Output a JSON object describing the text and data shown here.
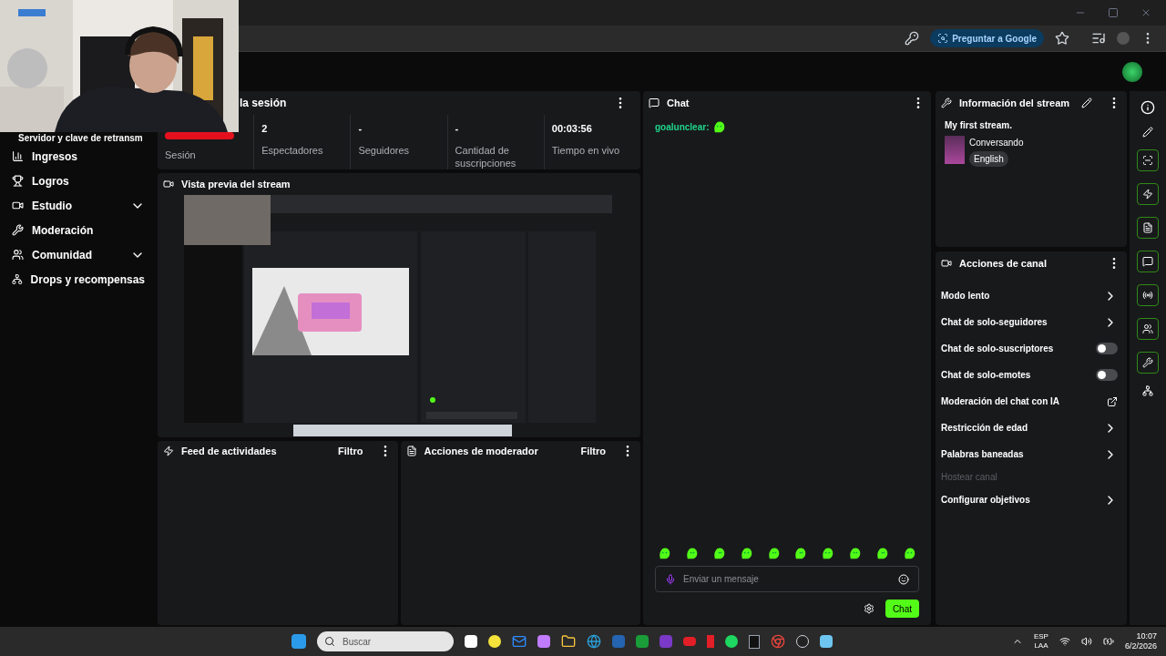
{
  "browser": {
    "ask_button": "Preguntar a Google"
  },
  "sidebar": {
    "partial_item": "Servidor y clave de retransm",
    "items": [
      {
        "label": "Ingresos",
        "expandable": false
      },
      {
        "label": "Logros",
        "expandable": false
      },
      {
        "label": "Estudio",
        "expandable": true
      },
      {
        "label": "Moderación",
        "expandable": false
      },
      {
        "label": "Comunidad",
        "expandable": true
      },
      {
        "label": "Drops y recompensas",
        "expandable": false
      }
    ]
  },
  "session": {
    "title": "la sesión",
    "stats": [
      {
        "kind": "badge",
        "label": "Sesión"
      },
      {
        "kind": "value",
        "value": "2",
        "label": "Espectadores"
      },
      {
        "kind": "value",
        "value": "-",
        "label": "Seguidores"
      },
      {
        "kind": "value",
        "value": "-",
        "label": "Cantidad de suscripciones"
      },
      {
        "kind": "value",
        "value": "00:03:56",
        "label": "Tiempo en vivo"
      }
    ]
  },
  "preview": {
    "title": "Vista previa del stream"
  },
  "feeds": [
    {
      "title": "Feed de actividades",
      "filter": "Filtro"
    },
    {
      "title": "Acciones de moderador",
      "filter": "Filtro"
    }
  ],
  "chat": {
    "title": "Chat",
    "messages": [
      {
        "user": "goalunclear:"
      }
    ],
    "placeholder": "Enviar un mensaje",
    "send": "Chat"
  },
  "stream_info": {
    "title": "Información del stream",
    "stream_title": "My first stream.",
    "category": "Conversando",
    "tag": "English"
  },
  "channel_actions": {
    "title": "Acciones de canal",
    "items": [
      {
        "label": "Modo lento",
        "kind": "arrow",
        "disabled": false
      },
      {
        "label": "Chat de solo-seguidores",
        "kind": "arrow",
        "disabled": false
      },
      {
        "label": "Chat de solo-suscriptores",
        "kind": "toggle",
        "on": false,
        "disabled": false
      },
      {
        "label": "Chat de solo-emotes",
        "kind": "toggle",
        "on": false,
        "disabled": false
      },
      {
        "label": "Moderación del chat con IA",
        "kind": "external",
        "disabled": false
      },
      {
        "label": "Restricción de edad",
        "kind": "arrow",
        "disabled": false
      },
      {
        "label": "Palabras baneadas",
        "kind": "arrow",
        "disabled": false
      },
      {
        "label": "Hostear canal",
        "kind": "none",
        "disabled": true
      },
      {
        "label": "Configurar objetivos",
        "kind": "arrow",
        "disabled": false
      }
    ]
  },
  "taskbar": {
    "search_placeholder": "Buscar",
    "language": "ESP",
    "layout": "LAA",
    "time": "10:07",
    "date": "6/2/2026"
  }
}
